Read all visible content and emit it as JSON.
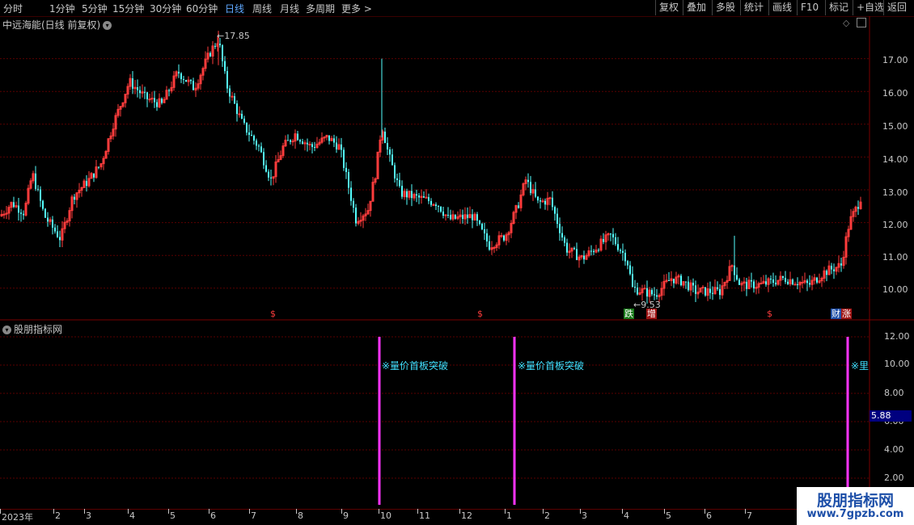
{
  "toolbar": {
    "periods": [
      "分时",
      "1分钟",
      "5分钟",
      "15分钟",
      "30分钟",
      "60分钟",
      "日线",
      "周线",
      "月线",
      "多周期",
      "更多 >"
    ],
    "active_period": "日线",
    "tools": [
      "复权",
      "叠加",
      "多股",
      "统计",
      "画线",
      "F10",
      "标记",
      "+自选",
      "返回"
    ]
  },
  "main_panel": {
    "title": "中远海能(日线 前复权)",
    "high_marker": "17.85",
    "low_marker": "9.53",
    "price_ticks": [
      "17.00",
      "16.00",
      "15.00",
      "14.00",
      "13.00",
      "12.00",
      "11.00",
      "10.00"
    ],
    "event_markers": [
      "$",
      "$",
      "跌",
      "增",
      "$",
      "财",
      "涨"
    ]
  },
  "indicator_panel": {
    "title": "股朋指标网",
    "signal_label": "※量价首板突破",
    "signal_label_cut": "※里",
    "current_value": "5.88",
    "ticks": [
      "12.00",
      "10.00",
      "8.00",
      "6.00",
      "4.00",
      "2.00"
    ]
  },
  "time_axis": {
    "labels": [
      "2023年",
      "2",
      "3",
      "4",
      "5",
      "6",
      "7",
      "8",
      "9",
      "10",
      "11",
      "12",
      "1",
      "2",
      "3",
      "4",
      "5",
      "6",
      "7"
    ]
  },
  "watermark": {
    "title": "股朋指标网",
    "url": "www.7gpzb.com"
  },
  "colors": {
    "up": "#ff3c3c",
    "down": "#54ffff",
    "grid": "#5a0000",
    "signal": "#ff33ff",
    "highlight": "#00007f"
  },
  "chart_data": {
    "type": "candlestick",
    "series": [
      {
        "name": "日线",
        "note": "approximate price trajectory (close)",
        "x": [
          "2023-01",
          "2023-02",
          "2023-03",
          "2023-04",
          "2023-05",
          "2023-06",
          "2023-07",
          "2023-08",
          "2023-09",
          "2023-10",
          "2023-11",
          "2023-12",
          "2024-01",
          "2024-02",
          "2024-03",
          "2024-04",
          "2024-05",
          "2024-06",
          "2024-07"
        ],
        "values": [
          12.3,
          12.6,
          13.8,
          16.3,
          16.6,
          16.8,
          14.6,
          14.6,
          12.2,
          14.2,
          12.8,
          12.1,
          11.6,
          12.6,
          11.0,
          10.1,
          10.3,
          10.2,
          12.8
        ]
      }
    ],
    "ylim": [
      9.5,
      18.0
    ]
  }
}
